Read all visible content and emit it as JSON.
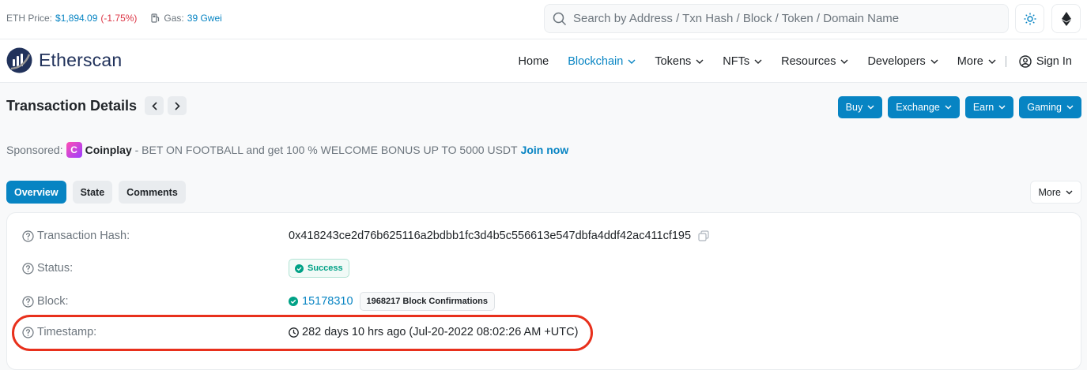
{
  "topbar": {
    "eth_price_label": "ETH Price:",
    "eth_price_value": "$1,894.09",
    "eth_price_change": "(-1.75%)",
    "gas_label": "Gas:",
    "gas_value": "39 Gwei",
    "search_placeholder": "Search by Address / Txn Hash / Block / Token / Domain Name"
  },
  "nav": {
    "brand": "Etherscan",
    "items": [
      {
        "label": "Home"
      },
      {
        "label": "Blockchain"
      },
      {
        "label": "Tokens"
      },
      {
        "label": "NFTs"
      },
      {
        "label": "Resources"
      },
      {
        "label": "Developers"
      },
      {
        "label": "More"
      }
    ],
    "signin": "Sign In"
  },
  "page": {
    "title": "Transaction Details",
    "action_buttons": [
      "Buy",
      "Exchange",
      "Earn",
      "Gaming"
    ]
  },
  "sponsored": {
    "label": "Sponsored:",
    "brand": "Coinplay",
    "text": " - BET ON FOOTBALL and get 100 % WELCOME BONUS UP TO 5000 USDT",
    "cta": "Join now"
  },
  "tabs": [
    "Overview",
    "State",
    "Comments"
  ],
  "more_label": "More",
  "details": {
    "hash_label": "Transaction Hash:",
    "hash_value": "0x418243ce2d76b625116a2bdbb1fc3d4b5c556613e547dbfa4ddf42ac411cf195",
    "status_label": "Status:",
    "status_value": "Success",
    "block_label": "Block:",
    "block_value": "15178310",
    "block_confirmations": "1968217 Block Confirmations",
    "timestamp_label": "Timestamp:",
    "timestamp_value": "282 days 10 hrs ago (Jul-20-2022 08:02:26 AM +UTC)"
  },
  "colors": {
    "accent": "#0784c3",
    "success": "#00a186",
    "negative": "#dc3545",
    "highlight": "#e8301c"
  }
}
